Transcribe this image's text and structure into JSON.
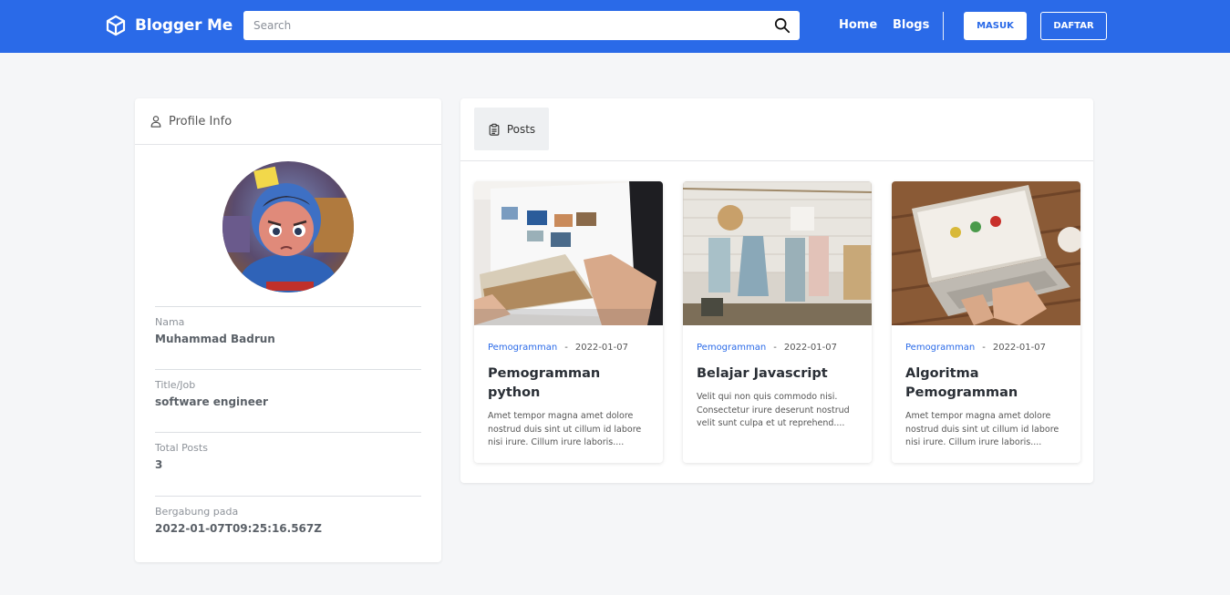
{
  "navbar": {
    "brand": "Blogger Me",
    "search_placeholder": "Search",
    "links": [
      "Home",
      "Blogs"
    ],
    "login_label": "MASUK",
    "register_label": "DAFTAR",
    "accent": "#2a6ae8"
  },
  "profile": {
    "header": "Profile Info",
    "fields": [
      {
        "label": "Nama",
        "value": "Muhammad Badrun"
      },
      {
        "label": "Title/Job",
        "value": "software engineer"
      },
      {
        "label": "Total Posts",
        "value": "3"
      },
      {
        "label": "Bergabung pada",
        "value": "2022-01-07T09:25:16.567Z"
      }
    ]
  },
  "posts": {
    "tab_label": "Posts",
    "items": [
      {
        "category": "Pemogramman",
        "separator": "-",
        "date": "2022-01-07",
        "title": "Pemogramman python",
        "excerpt": "Amet tempor magna amet dolore nostrud duis sint ut cillum id labore nisi irure. Cillum irure laboris...."
      },
      {
        "category": "Pemogramman",
        "separator": "-",
        "date": "2022-01-07",
        "title": "Belajar Javascript",
        "excerpt": "Velit qui non quis commodo nisi. Consectetur irure deserunt nostrud velit sunt culpa et ut reprehend...."
      },
      {
        "category": "Pemogramman",
        "separator": "-",
        "date": "2022-01-07",
        "title": "Algoritma Pemogramman",
        "excerpt": "Amet tempor magna amet dolore nostrud duis sint ut cillum id labore nisi irure. Cillum irure laboris...."
      }
    ]
  }
}
